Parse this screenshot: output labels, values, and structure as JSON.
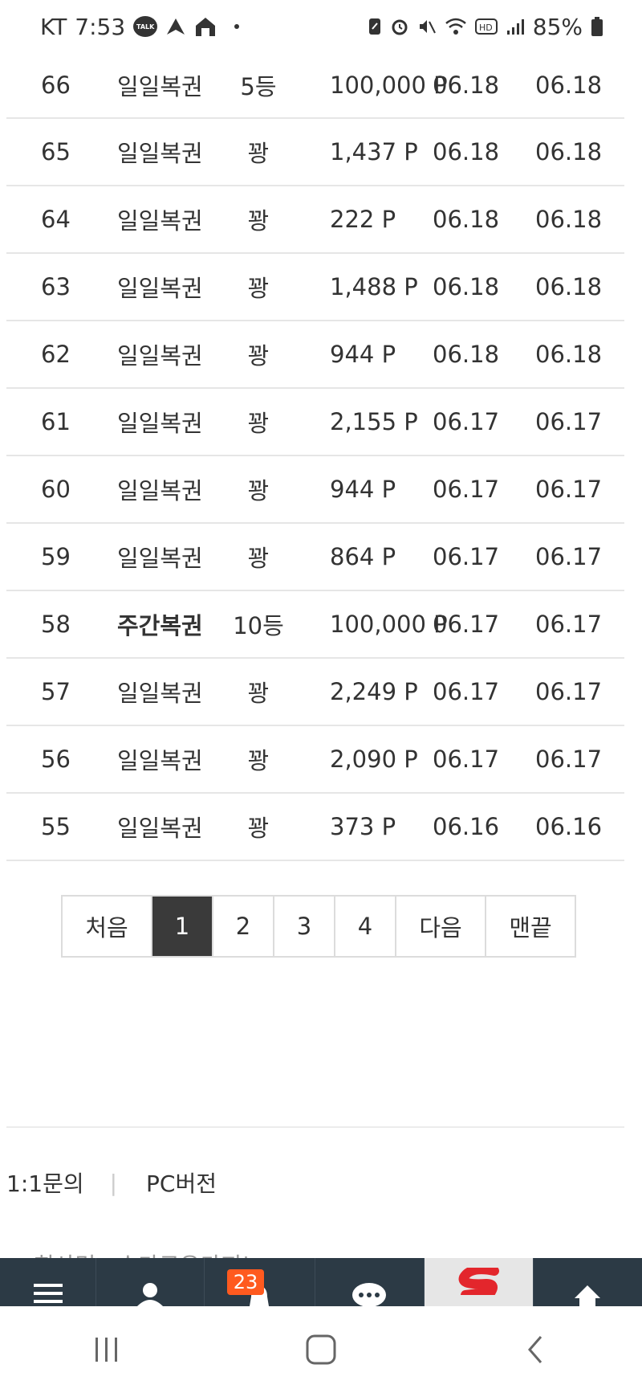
{
  "status_bar": {
    "carrier": "KT",
    "time": "7:53",
    "talk_label": "TALK",
    "battery": "85%"
  },
  "rows": [
    {
      "no": "66",
      "type": "일일복권",
      "rank": "5등",
      "point": "100,000 P",
      "date1": "06.18",
      "date2": "06.18",
      "bold": false
    },
    {
      "no": "65",
      "type": "일일복권",
      "rank": "꽝",
      "point": "1,437 P",
      "date1": "06.18",
      "date2": "06.18",
      "bold": false
    },
    {
      "no": "64",
      "type": "일일복권",
      "rank": "꽝",
      "point": "222 P",
      "date1": "06.18",
      "date2": "06.18",
      "bold": false
    },
    {
      "no": "63",
      "type": "일일복권",
      "rank": "꽝",
      "point": "1,488 P",
      "date1": "06.18",
      "date2": "06.18",
      "bold": false
    },
    {
      "no": "62",
      "type": "일일복권",
      "rank": "꽝",
      "point": "944 P",
      "date1": "06.18",
      "date2": "06.18",
      "bold": false
    },
    {
      "no": "61",
      "type": "일일복권",
      "rank": "꽝",
      "point": "2,155 P",
      "date1": "06.17",
      "date2": "06.17",
      "bold": false
    },
    {
      "no": "60",
      "type": "일일복권",
      "rank": "꽝",
      "point": "944 P",
      "date1": "06.17",
      "date2": "06.17",
      "bold": false
    },
    {
      "no": "59",
      "type": "일일복권",
      "rank": "꽝",
      "point": "864 P",
      "date1": "06.17",
      "date2": "06.17",
      "bold": false
    },
    {
      "no": "58",
      "type": "주간복권",
      "rank": "10등",
      "point": "100,000 P",
      "date1": "06.17",
      "date2": "06.17",
      "bold": true
    },
    {
      "no": "57",
      "type": "일일복권",
      "rank": "꽝",
      "point": "2,249 P",
      "date1": "06.17",
      "date2": "06.17",
      "bold": false
    },
    {
      "no": "56",
      "type": "일일복권",
      "rank": "꽝",
      "point": "2,090 P",
      "date1": "06.17",
      "date2": "06.17",
      "bold": false
    },
    {
      "no": "55",
      "type": "일일복권",
      "rank": "꽝",
      "point": "373 P",
      "date1": "06.16",
      "date2": "06.16",
      "bold": false
    }
  ],
  "pagination": {
    "first": "처음",
    "pages": [
      "1",
      "2",
      "3",
      "4"
    ],
    "current": "1",
    "next": "다음",
    "last": "맨끝"
  },
  "footer": {
    "inquiry": "1:1문의",
    "separator": "|",
    "pc_version": "PC버전",
    "company_peek": "회사명 : 슈가로우카지노"
  },
  "toolbar": {
    "notification_count": "23",
    "icons": [
      "menu-icon",
      "user-icon",
      "bell-icon",
      "chat-icon",
      "logo-icon",
      "arrow-up-icon"
    ],
    "logo_color": "#e3262c",
    "bg_color": "#2c3a45",
    "badge_color": "#ff5a1f"
  },
  "nav_bar": {
    "icons": [
      "recent-apps-icon",
      "home-icon",
      "back-icon"
    ]
  }
}
